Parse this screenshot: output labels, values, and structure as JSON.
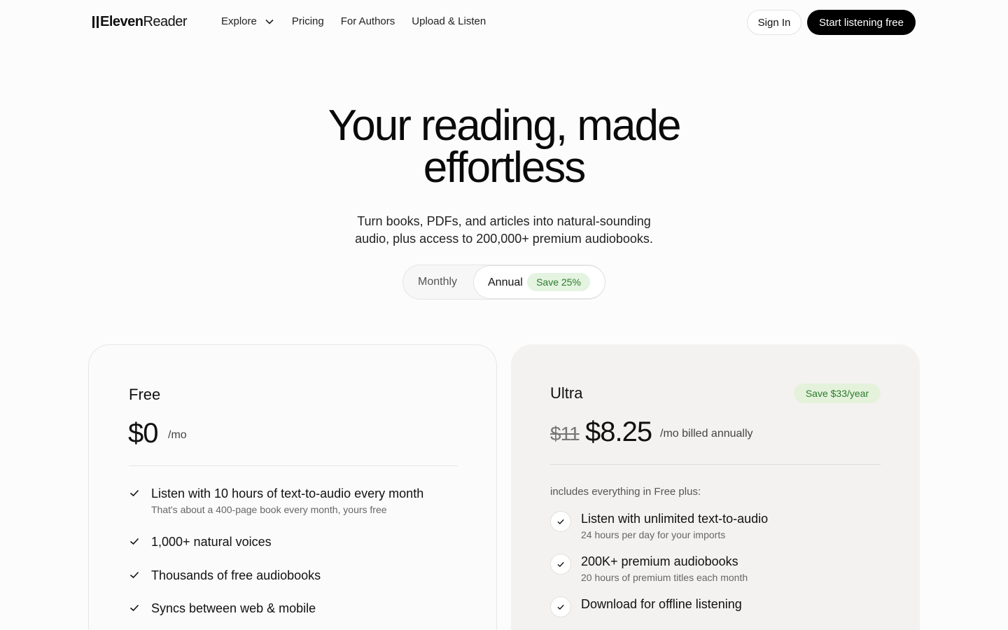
{
  "brand": {
    "logo_bold": "Eleven",
    "logo_light": "Reader"
  },
  "nav": {
    "links": [
      {
        "label": "Explore"
      },
      {
        "label": "Pricing"
      },
      {
        "label": "For Authors"
      },
      {
        "label": "Upload & Listen"
      }
    ],
    "sign_in": "Sign In",
    "cta": "Start listening free"
  },
  "hero": {
    "title_line1": "Your reading, made",
    "title_line2": "effortless",
    "subtitle_line1": "Turn books, PDFs, and articles into natural-sounding",
    "subtitle_line2": "audio, plus access to 200,000+ premium audiobooks."
  },
  "billing_toggle": {
    "monthly": "Monthly",
    "annual": "Annual",
    "annual_badge": "Save 25%",
    "selected": "Annual"
  },
  "plans": {
    "free": {
      "name": "Free",
      "price": "$0",
      "unit": "/mo",
      "features": [
        {
          "title": "Listen with 10 hours of text-to-audio every month",
          "sub": "That's about a 400-page book every month, yours free"
        },
        {
          "title": "1,000+ natural voices"
        },
        {
          "title": "Thousands of free audiobooks"
        },
        {
          "title": "Syncs between web & mobile"
        }
      ]
    },
    "ultra": {
      "name": "Ultra",
      "badge": "Save $33/year",
      "old_price": "$11",
      "price": "$8.25",
      "unit": "/mo billed annually",
      "includes": "includes everything in Free plus:",
      "features": [
        {
          "title": "Listen with unlimited text-to-audio",
          "sub": "24 hours per day for your imports"
        },
        {
          "title": "200K+ premium audiobooks",
          "sub": "20 hours of premium titles each month"
        },
        {
          "title": "Download for offline listening"
        }
      ]
    }
  },
  "colors": {
    "accent_green_bg": "#e4f4e1",
    "accent_green_text": "#2b7a2b",
    "ultra_card_bg": "#f3f2f0",
    "cta_bg": "#000000"
  }
}
